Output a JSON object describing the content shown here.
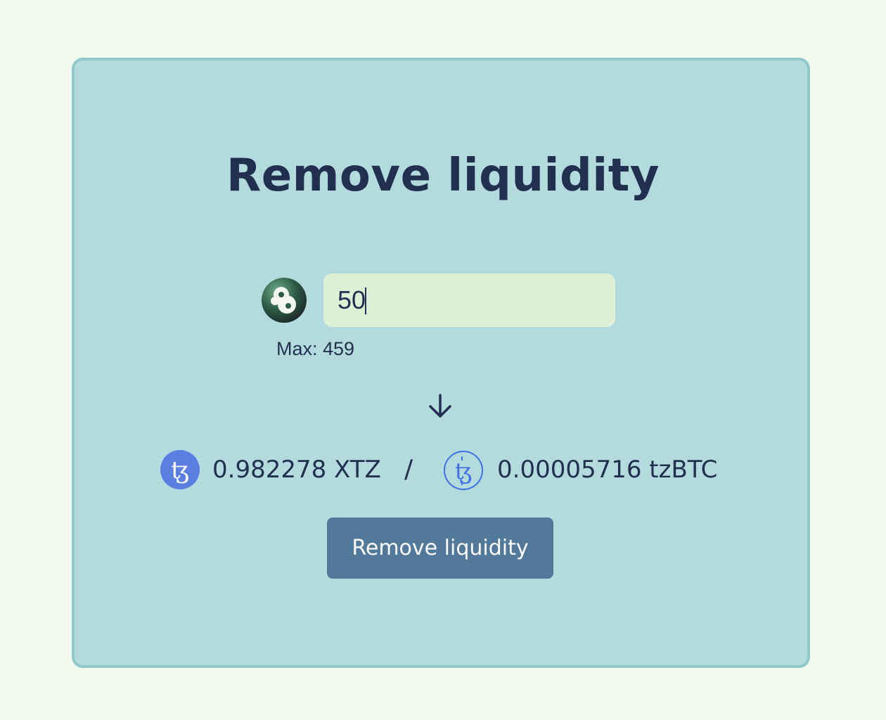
{
  "page": {
    "title": "Remove liquidity"
  },
  "lp_input": {
    "icon": "lp-token-icon",
    "value": "50",
    "max_label": "Max: 459"
  },
  "direction_icon": "arrow-down-icon",
  "outputs": {
    "xtz": {
      "icon": "tezos-xtz-icon",
      "amount": "0.982278 XTZ"
    },
    "separator": "/",
    "tzbtc": {
      "icon": "tzbtc-icon",
      "amount": "0.00005716 tzBTC"
    }
  },
  "submit_button": {
    "label": "Remove liquidity"
  },
  "colors": {
    "page_background": "#f2f9ee",
    "card_background": "#b3dbdd",
    "card_border": "#93c8ca",
    "text_primary": "#21304f",
    "input_background": "#ddefd4",
    "button_background": "#52789a",
    "tezos_blue": "#5a7fe0"
  }
}
